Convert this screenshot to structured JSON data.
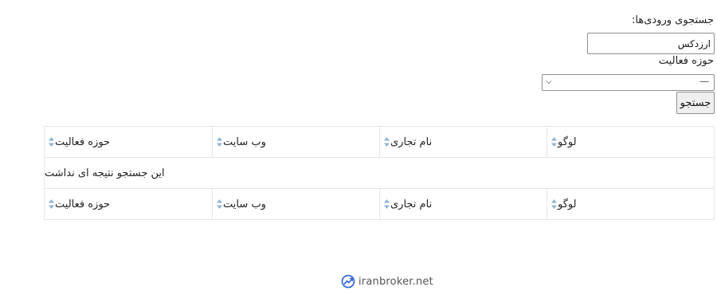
{
  "search": {
    "label": "جستجوی ورودی‌ها:",
    "input_value": "ارزدکس"
  },
  "activity_filter": {
    "label": "حوزه فعالیت",
    "selected": "—"
  },
  "search_button": {
    "label": "جستجو"
  },
  "table": {
    "columns": [
      "لوگو",
      "نام تجاری",
      "وب سایت",
      "حوزه فعالیت"
    ],
    "empty_message": "این جستجو نتیجه ای نداشت",
    "sort_icon_color": "#8fb3d9"
  },
  "footer": {
    "brand": "iranbroker.net",
    "logo_color": "#3b6fd8"
  }
}
